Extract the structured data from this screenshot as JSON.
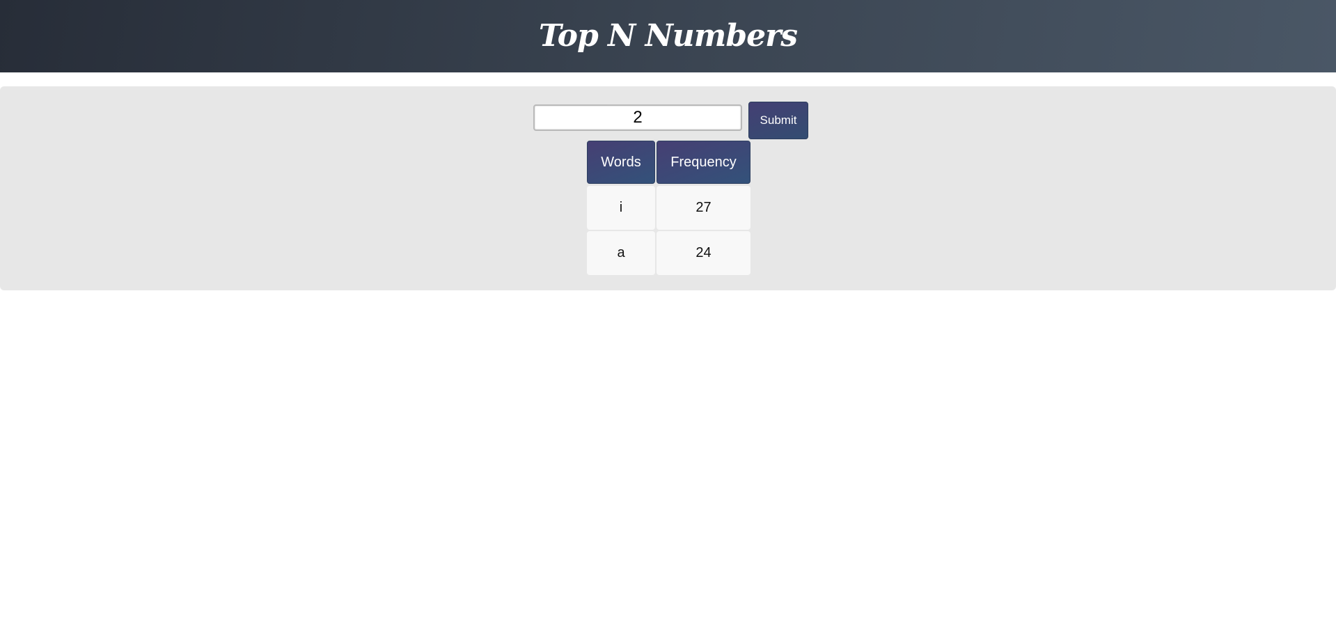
{
  "header": {
    "title": "Top N Numbers"
  },
  "form": {
    "input_value": "2",
    "submit_label": "Submit"
  },
  "table": {
    "headers": [
      "Words",
      "Frequency"
    ],
    "rows": [
      [
        "i",
        "27"
      ],
      [
        "a",
        "24"
      ]
    ]
  },
  "colors": {
    "header_bg_start": "#272d38",
    "header_bg_end": "#4a5766",
    "panel_bg": "#e7e7e7",
    "accent_start": "#443f73",
    "accent_end": "#334d72"
  }
}
